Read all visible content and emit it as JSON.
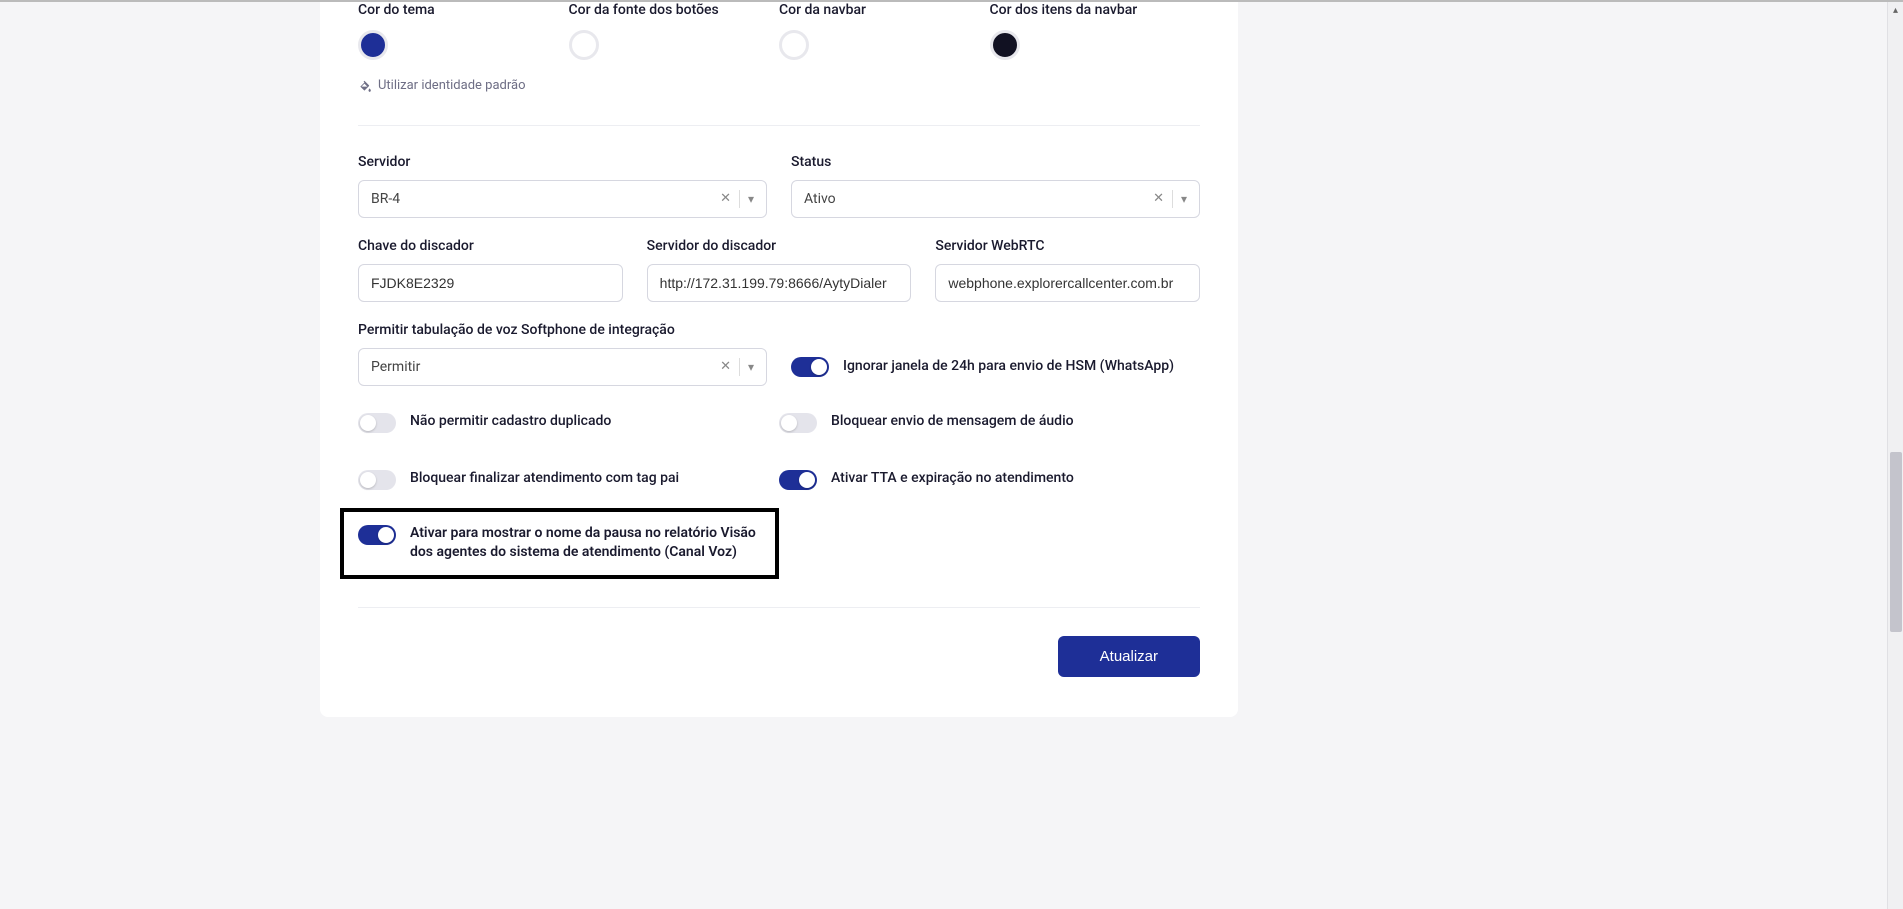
{
  "colors": {
    "theme_label": "Cor do tema",
    "button_font_label": "Cor da fonte dos botões",
    "navbar_label": "Cor da navbar",
    "navbar_items_label": "Cor dos itens da navbar",
    "theme_value": "#1e2f97",
    "button_font_value": "#ffffff",
    "navbar_value": "#ffffff",
    "navbar_items_value": "#111122"
  },
  "identity_link": "Utilizar identidade padrão",
  "server": {
    "label": "Servidor",
    "value": "BR-4"
  },
  "status": {
    "label": "Status",
    "value": "Ativo"
  },
  "dialer_key": {
    "label": "Chave do discador",
    "value": "FJDK8E2329"
  },
  "dialer_server": {
    "label": "Servidor do discador",
    "value": "http://172.31.199.79:8666/AytyDialer"
  },
  "webrtc_server": {
    "label": "Servidor WebRTC",
    "value": "webphone.explorercallcenter.com.br"
  },
  "voice_tab": {
    "label": "Permitir tabulação de voz Softphone de integração",
    "value": "Permitir"
  },
  "toggles": {
    "hsm": {
      "label": "Ignorar janela de 24h para envio de HSM (WhatsApp)",
      "on": true
    },
    "no_dup": {
      "label": "Não permitir cadastro duplicado",
      "on": false
    },
    "block_audio": {
      "label": "Bloquear envio de mensagem de áudio",
      "on": false
    },
    "block_finish": {
      "label": "Bloquear finalizar atendimento com tag pai",
      "on": false
    },
    "tta": {
      "label": "Ativar TTA e expiração no atendimento",
      "on": true
    },
    "pause_name": {
      "label": "Ativar para mostrar o nome da pausa no relatório Visão dos agentes do sistema de atendimento (Canal Voz)",
      "on": true
    }
  },
  "buttons": {
    "update": "Atualizar"
  }
}
